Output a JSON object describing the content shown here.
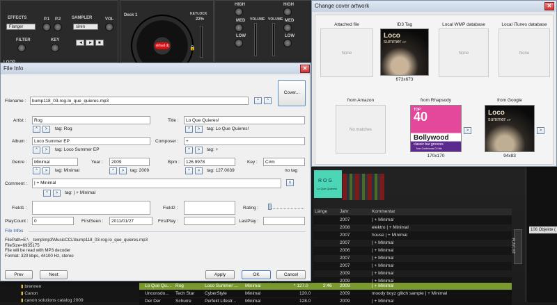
{
  "dj": {
    "effects_label": "EFFECTS",
    "effect_value": "Flanger",
    "p1_label": "P.1",
    "p2_label": "P.2",
    "sampler_label": "SAMPLER",
    "sampler_value": "siren",
    "vol_label": "VOL",
    "filter_label": "FILTER",
    "key_label": "KEY",
    "loop_label": "LOOP",
    "deck_label": "Deck 1",
    "keylock_label": "KEYLOCK",
    "pitch_value": "22%",
    "jog_brand": "virtual dj",
    "high_label": "HIGH",
    "med_label": "MED",
    "low_label": "LOW",
    "volume_label": "VOLUME",
    "side_count": "106 Objekte (",
    "playlist_tab": "PLAYLIST"
  },
  "file_info": {
    "title": "File Info",
    "filename_label": "Filename :",
    "filename_value": "bump118_03-rog-lo_que_quieres.mp3",
    "cover_button": "Cover...",
    "artist_label": "Artist :",
    "artist_value": "Rog",
    "artist_tag": "tag: Rog",
    "title_label": "Title :",
    "title_value": "Lo Que Quieres!",
    "title_tag": "tag: Lo Que Quieres!",
    "album_label": "Album :",
    "album_value": "Loco Summer EP",
    "album_tag": "tag: Loco Summer EP",
    "composer_label": "Composer :",
    "composer_value": "+",
    "composer_tag": "tag: +",
    "genre_label": "Genre :",
    "genre_value": "Minimal",
    "genre_tag": "tag: Minimal",
    "year_label": "Year :",
    "year_value": "2009",
    "year_tag": "tag: 2009",
    "bpm_label": "Bpm :",
    "bpm_value": "126.9978",
    "bpm_tag": "tag: 127.0039",
    "key_label": "Key :",
    "key_value": "C#m",
    "key_tag": "no tag",
    "comment_label": "Comment :",
    "comment_value": "| + Minimal",
    "comment_tag": "tag: | + Minimal",
    "comment_clear": "x",
    "field1_label": "Field1 :",
    "field1_value": "",
    "field2_label": "Field2 :",
    "field2_value": "",
    "rating_label": "Rating :",
    "playcount_label": "PlayCount :",
    "playcount_value": "0",
    "firstseen_label": "FirstSeen :",
    "firstseen_value": "2011/01/27",
    "firstplay_label": "FirstPlay :",
    "firstplay_value": "",
    "lastplay_label": "LastPlay :",
    "lastplay_value": "",
    "info_header": "File Infos",
    "info_lines": [
      "FilePath=E:\\__temp\\mp3\\MusicCCL\\bump118_03-rog-lo_que_quieres.mp3",
      "FileSize=6935175",
      "File will be read with MP3 decoder",
      "Format: 320 kbps, 44100 Hz, stereo"
    ],
    "prev_button": "Prev",
    "next_button": "Next",
    "apply_button": "Apply",
    "ok_button": "OK",
    "cancel_button": "Cancel"
  },
  "cover_artwork": {
    "title": "Change cover artwork",
    "sources": [
      {
        "header": "Attached file",
        "status": "None",
        "size": ""
      },
      {
        "header": "ID3 Tag",
        "status": "",
        "size": "673x673"
      },
      {
        "header": "Local WMP database",
        "status": "None",
        "size": ""
      },
      {
        "header": "Local iTunes database",
        "status": "None",
        "size": ""
      },
      {
        "header": "from Amazon",
        "status": "No matches",
        "size": ""
      },
      {
        "header": "from Rhapsody",
        "status": "",
        "size": "170x170"
      },
      {
        "header": "from Google",
        "status": "",
        "size": "94x83"
      }
    ],
    "loco_title": "Loco",
    "loco_subtitle": "summer",
    "loco_ep": "EP",
    "rhapsody_top": "TOP",
    "rhapsody_40": "40",
    "rhapsody_title": "Bollywood",
    "rhapsody_sub": "classic bar grooves",
    "rhapsody_foot": "Non-Continuous DJ Mix"
  },
  "browser": {
    "thumb_text": "ROG",
    "thumb_sub": "Lo Que Quieres!",
    "columns": {
      "length": "Länge",
      "year": "Jahr",
      "comment": "Kommentar"
    },
    "rows": [
      {
        "year": "2007",
        "comment": "| + Minimal"
      },
      {
        "year": "2008",
        "comment": "elektro | + Minimal"
      },
      {
        "year": "2007",
        "comment": "house | + Minimal"
      },
      {
        "year": "2007",
        "comment": "| + Minimal"
      },
      {
        "year": "2006",
        "comment": "| + Minimal"
      },
      {
        "year": "2007",
        "comment": "| + Minimal"
      },
      {
        "year": "2007",
        "comment": "| + Minimal"
      },
      {
        "year": "2009",
        "comment": "| + Minimal"
      },
      {
        "year": "2009",
        "comment": "| + Minimal"
      }
    ],
    "selected_row": {
      "title": "Lo Que Qu...",
      "artist": "Rog",
      "album": "Loco Summer ...",
      "genre": "Minimal",
      "bpm": "* 127.0",
      "length": "2:46",
      "year": "2009",
      "comment": "| + Minimal"
    },
    "row2": {
      "title": "Unconsdo...",
      "artist": "Tech Star",
      "album": "CyberStyle",
      "genre": "Minimal",
      "bpm": "120.0",
      "year": "2009",
      "comment": "moody boyz glitch sample | + Minimal"
    },
    "row3": {
      "title": "Der Der",
      "artist": "Schurre",
      "album": "Perfekt Lifestr...",
      "genre": "Minimal",
      "bpm": "128.0",
      "year": "2009",
      "comment": "| + Minimal"
    },
    "tree": [
      "brennen",
      "Canon",
      "canon solutions catalog 2009"
    ]
  },
  "colors": {
    "accent_green": "#7a9a30",
    "deck_red": "#d11111"
  }
}
